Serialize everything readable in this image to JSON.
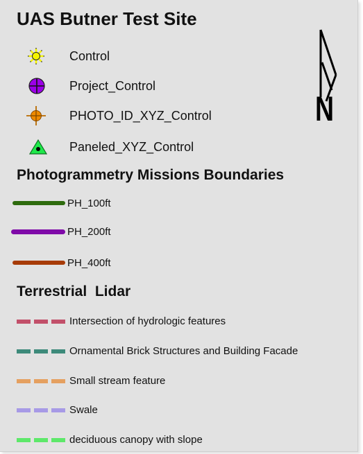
{
  "legend": {
    "title": "UAS Butner Test Site",
    "control_items": [
      {
        "label": "Control",
        "icon": "sun-icon",
        "color": "#f5f500"
      },
      {
        "label": "Project_Control",
        "icon": "circle-cross-icon",
        "color": "#9b00e8"
      },
      {
        "label": "PHOTO_ID_XYZ_Control",
        "icon": "crosshair-icon",
        "color": "#ef8a00"
      },
      {
        "label": "Paneled_XYZ_Control",
        "icon": "triangle-dot-icon",
        "color": "#1ee84a"
      }
    ],
    "boundaries_heading": "Photogrammetry Missions Boundaries",
    "boundaries": [
      {
        "label": "PH_100ft",
        "color": "#2e6b0e"
      },
      {
        "label": "PH_200ft",
        "color": "#7f0aa8"
      },
      {
        "label": "PH_400ft",
        "color": "#a73b08"
      }
    ],
    "lidar_heading": "Terrestrial  Lidar",
    "lidar_items": [
      {
        "label": "Intersection of hydrologic features",
        "color": "#c2506a"
      },
      {
        "label": "Ornamental Brick Structures and Building Facade",
        "color": "#3d8a7a"
      },
      {
        "label": "Small stream feature",
        "color": "#e5a060"
      },
      {
        "label": "Swale",
        "color": "#a79ae6"
      },
      {
        "label": "deciduous canopy with slope",
        "color": "#5ee86a"
      }
    ],
    "north_arrow": {
      "icon": "north-arrow-icon",
      "letter": "N"
    }
  }
}
